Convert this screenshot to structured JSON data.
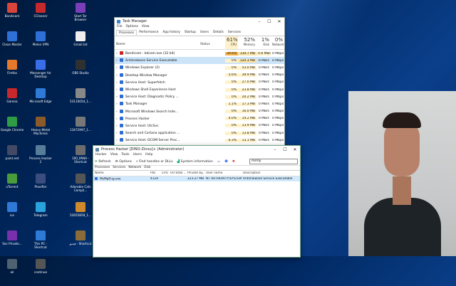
{
  "desktop": {
    "col1": [
      {
        "label": "Bandicam",
        "color": "#d9453a"
      },
      {
        "label": "Clean Master",
        "color": "#2e6fd8"
      },
      {
        "label": "Firefox",
        "color": "#e4782b"
      },
      {
        "label": "Garena",
        "color": "#c6282b"
      },
      {
        "label": "Google Chrome",
        "color": "#2e9b45"
      },
      {
        "label": "paint.net",
        "color": "#444a66"
      },
      {
        "label": "uTorrent",
        "color": "#4a9c3a"
      },
      {
        "label": "ice",
        "color": "#2f7ad6"
      },
      {
        "label": "Sec Private...",
        "color": "#7a2fae"
      },
      {
        "label": "ail",
        "color": "#4f6270"
      }
    ],
    "col2": [
      {
        "label": "CCleaner",
        "color": "#c6282b"
      },
      {
        "label": "Melon VPN",
        "color": "#2e6fd8"
      },
      {
        "label": "Messenger for Desktop",
        "color": "#3a6ee8"
      },
      {
        "label": "Microsoft Edge",
        "color": "#2f7ad6"
      },
      {
        "label": "Heavy Metal Machines",
        "color": "#8a5a2a"
      },
      {
        "label": "Process Hacker 2",
        "color": "#567d9a"
      },
      {
        "label": "Proxifier",
        "color": "#3a4d7e"
      },
      {
        "label": "Telegram",
        "color": "#2aa3dc"
      },
      {
        "label": "This PC - Shortcut",
        "color": "#2f7ad6"
      },
      {
        "label": "continue",
        "color": "#555"
      }
    ],
    "col3": [
      {
        "label": "Start Tor Browser",
        "color": "#7a3fb8"
      },
      {
        "label": "Gmail.txt",
        "color": "#eee"
      },
      {
        "label": "OBS Studio",
        "color": "#303030"
      },
      {
        "label": "53110054_1...",
        "color": "#888"
      },
      {
        "label": "13472997_1...",
        "color": "#777"
      },
      {
        "label": "100_PANA - Shortcut",
        "color": "#6c6c6c"
      },
      {
        "label": "Adorable Cats Compil...",
        "color": "#555"
      },
      {
        "label": "52655859_1...",
        "color": "#d08a2c"
      },
      {
        "label": "فيديو - Shortcut",
        "color": "#8b6b3a"
      }
    ]
  },
  "taskmgr": {
    "title": "Task Manager",
    "menu": [
      "File",
      "Options",
      "View"
    ],
    "tabs": [
      "Processes",
      "Performance",
      "App history",
      "Startup",
      "Users",
      "Details",
      "Services"
    ],
    "head": {
      "name": "Name",
      "status": "Status",
      "cpu_pct": "61%",
      "cpu": "CPU",
      "mem_pct": "52%",
      "mem": "Memory",
      "disk_pct": "1%",
      "disk": "Disk",
      "net_pct": "0%",
      "net": "Network"
    },
    "rows": [
      {
        "name": "Bandicam - bdcam.exe (32 bit)",
        "cpu": "39.6%",
        "mem": "134.7 MB",
        "disk": "0.8 MB/s",
        "net": "0 Mbps"
      },
      {
        "name": "Antimalware Service Executable",
        "cpu": "0%",
        "mem": "124.3 MB",
        "disk": "0 MB/s",
        "net": "0 Mbps"
      },
      {
        "name": "Windows Explorer (2)",
        "cpu": "0%",
        "mem": "53.0 MB",
        "disk": "0 MB/s",
        "net": "0 Mbps"
      },
      {
        "name": "Desktop Window Manager",
        "cpu": "5.6%",
        "mem": "39.9 MB",
        "disk": "0 MB/s",
        "net": "0 Mbps"
      },
      {
        "name": "Service Host: Superfetch",
        "cpu": "0%",
        "mem": "27.0 MB",
        "disk": "0 MB/s",
        "net": "0 Mbps"
      },
      {
        "name": "Windows Shell Experience Host",
        "cpu": "0%",
        "mem": "23.8 MB",
        "disk": "0 MB/s",
        "net": "0 Mbps"
      },
      {
        "name": "Service Host: Diagnostic Policy ...",
        "cpu": "0%",
        "mem": "20.2 MB",
        "disk": "0 MB/s",
        "net": "0 Mbps"
      },
      {
        "name": "Task Manager",
        "cpu": "1.1%",
        "mem": "17.3 MB",
        "disk": "0 MB/s",
        "net": "0 Mbps"
      },
      {
        "name": "Microsoft Windows Search Inde...",
        "cpu": "0%",
        "mem": "16.0 MB",
        "disk": "0 MB/s",
        "net": "0 Mbps"
      },
      {
        "name": "Process Hacker",
        "cpu": "4.0%",
        "mem": "14.2 MB",
        "disk": "0 MB/s",
        "net": "0 Mbps"
      },
      {
        "name": "Service Host: UtcSvc",
        "cpu": "0%",
        "mem": "13.9 MB",
        "disk": "0 MB/s",
        "net": "0 Mbps"
      },
      {
        "name": "Search and Cortana application ...",
        "cpu": "0%",
        "mem": "13.8 MB",
        "disk": "0 MB/s",
        "net": "0 Mbps"
      },
      {
        "name": "Service Host: DCOM Server Proc...",
        "cpu": "0.3%",
        "mem": "13.1 MB",
        "disk": "0 MB/s",
        "net": "0 Mbps"
      }
    ]
  },
  "phacker": {
    "title": "Process Hacker [DINO-Zinou]+ (Administrator)",
    "menu": [
      "Hacker",
      "View",
      "Tools",
      "Users",
      "Help"
    ],
    "toolbar": {
      "refresh": "Refresh",
      "options": "Options",
      "find": "Find handles or DLLs",
      "sysinfo": "System information"
    },
    "search_value": "msmp",
    "tabs": [
      "Processes",
      "Services",
      "Network",
      "Disk"
    ],
    "head": {
      "name": "Name",
      "pid": "PID",
      "cpu": "CPU",
      "io": "I/O total ...",
      "priv": "Private by...",
      "user": "User name",
      "desc": "Description"
    },
    "row": {
      "name": "MsMpEng.exe",
      "pid": "4124",
      "cpu": "",
      "io": "",
      "priv": "223.27 MB",
      "user": "NT AUTHORITY\\SYSTEM",
      "desc": "Antimalware Service Executable"
    }
  }
}
